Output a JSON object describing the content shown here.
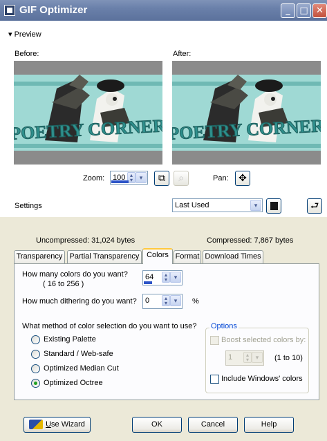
{
  "window": {
    "title": "GIF Optimizer",
    "controls": {
      "minimize": "_",
      "maximize": "□",
      "close": "✕"
    }
  },
  "preview": {
    "toggle_label": "▾ Preview",
    "before_label": "Before:",
    "after_label": "After:",
    "image_text": "POETRY CORNER",
    "zoom_label": "Zoom:",
    "zoom_value": "100",
    "pan_label": "Pan:"
  },
  "settings": {
    "label": "Settings",
    "preset_value": "Last Used"
  },
  "sizes": {
    "uncompressed": "Uncompressed:  31,024 bytes",
    "compressed": "Compressed: 7,867 bytes"
  },
  "tabs": [
    {
      "label": "Transparency"
    },
    {
      "label": "Partial Transparency"
    },
    {
      "label": "Colors"
    },
    {
      "label": "Format"
    },
    {
      "label": "Download Times"
    }
  ],
  "colors_tab": {
    "colors_question": "How many colors do you want?",
    "colors_range": "( 16  to  256 )",
    "colors_value": "64",
    "dither_question": "How much dithering do you want?",
    "dither_value": "0",
    "dither_unit": "%",
    "method_question": "What method of color selection do you want to use?",
    "methods": [
      {
        "label": "Existing Palette",
        "checked": false
      },
      {
        "label": "Standard / Web-safe",
        "checked": false
      },
      {
        "label": "Optimized Median Cut",
        "checked": false
      },
      {
        "label": "Optimized Octree",
        "checked": true
      }
    ],
    "options": {
      "title": "Options",
      "boost_label": "Boost selected colors by:",
      "boost_value": "1",
      "boost_range": "(1 to 10)",
      "include_windows_label": "Include Windows' colors"
    }
  },
  "buttons": {
    "wizard_prefix": "U",
    "wizard_rest": "se Wizard",
    "ok": "OK",
    "cancel": "Cancel",
    "help": "Help"
  },
  "colors": {
    "titlebar": "#6a80aa",
    "dialog_bg": "#ece9d8",
    "preview_teal": "#9fd9d4",
    "preview_text": "#2e8f8c",
    "accent_blue": "#2c53c7",
    "radio_checked": "#21a121"
  }
}
